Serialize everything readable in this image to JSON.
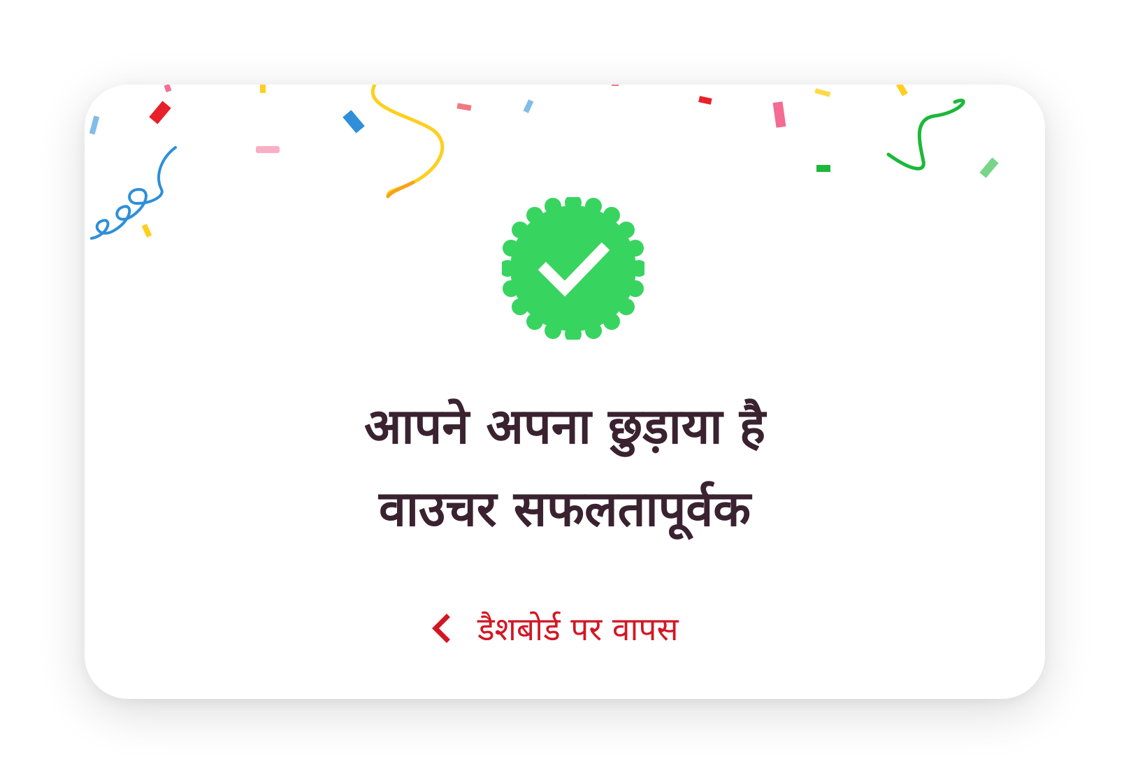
{
  "success": {
    "title_line_1": "आपने अपना छुड़ाया है",
    "title_line_2": "वाउचर सफलतापूर्वक",
    "badge_icon": "verified-check-icon",
    "badge_color": "#38d460"
  },
  "back_link": {
    "label": "डैशबोर्ड पर वापस",
    "icon": "chevron-left-icon",
    "color": "#d31624"
  },
  "decoration": {
    "confetti_colors": [
      "#e8202a",
      "#f56b93",
      "#ffcf1f",
      "#2e8fd8",
      "#1cb83a",
      "#f7a21b"
    ]
  }
}
